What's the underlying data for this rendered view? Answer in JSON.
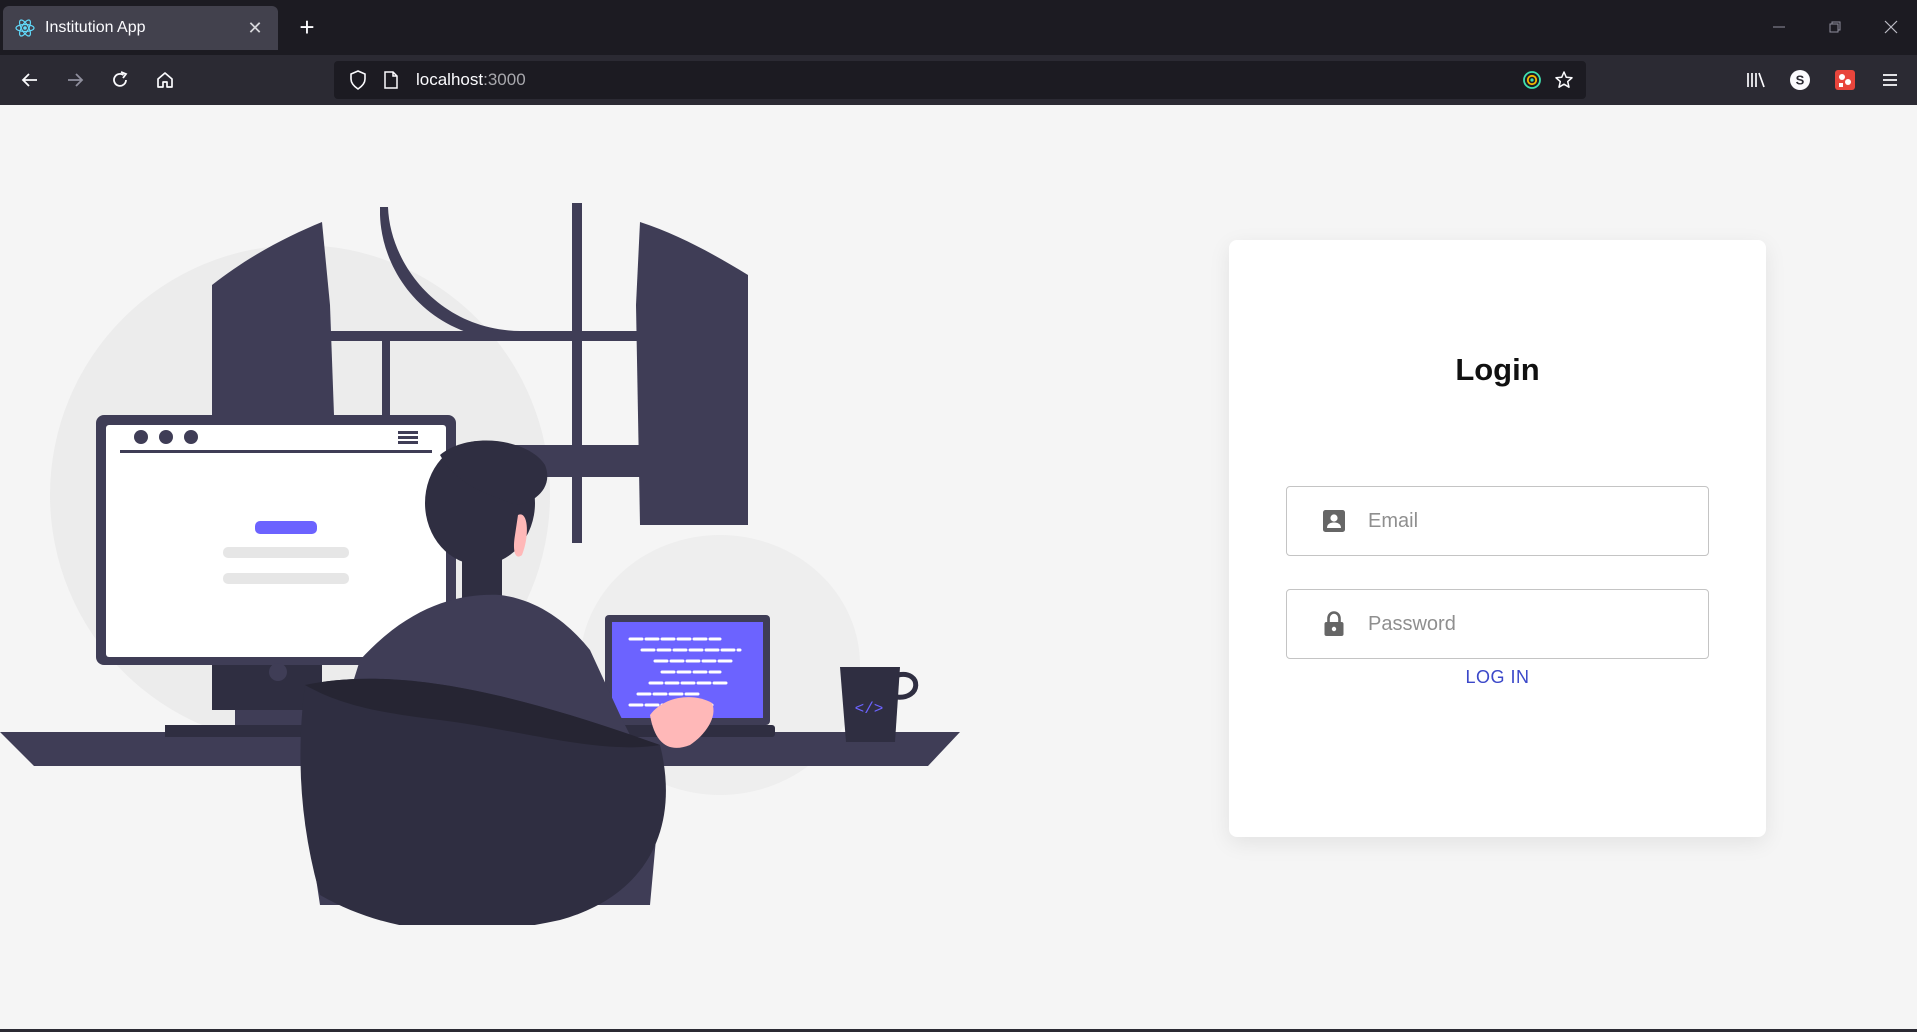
{
  "browser": {
    "tab_title": "Institution App",
    "url_host": "localhost",
    "url_port": ":3000",
    "icons": {
      "tab_favicon": "react-icon",
      "tab_close": "close-icon",
      "new_tab": "plus-icon",
      "minimize": "minimize-icon",
      "restore": "restore-icon",
      "close_window": "close-icon",
      "back": "back-arrow-icon",
      "forward": "forward-arrow-icon",
      "reload": "reload-icon",
      "home": "home-icon",
      "shield": "shield-icon",
      "page": "page-icon",
      "extension": "target-icon",
      "bookmark": "star-icon",
      "library": "library-icon",
      "account": "account-s-icon",
      "addon": "addon-icon",
      "menu": "hamburger-icon"
    }
  },
  "login": {
    "title": "Login",
    "email_placeholder": "Email",
    "password_placeholder": "Password",
    "button_label": "LOG IN",
    "email_icon": "contact-card-icon",
    "password_icon": "lock-icon"
  },
  "colors": {
    "accent": "#3b48c9",
    "illustration_primary": "#6c63ff",
    "illustration_dark": "#3f3d56",
    "background": "#f5f5f5"
  }
}
